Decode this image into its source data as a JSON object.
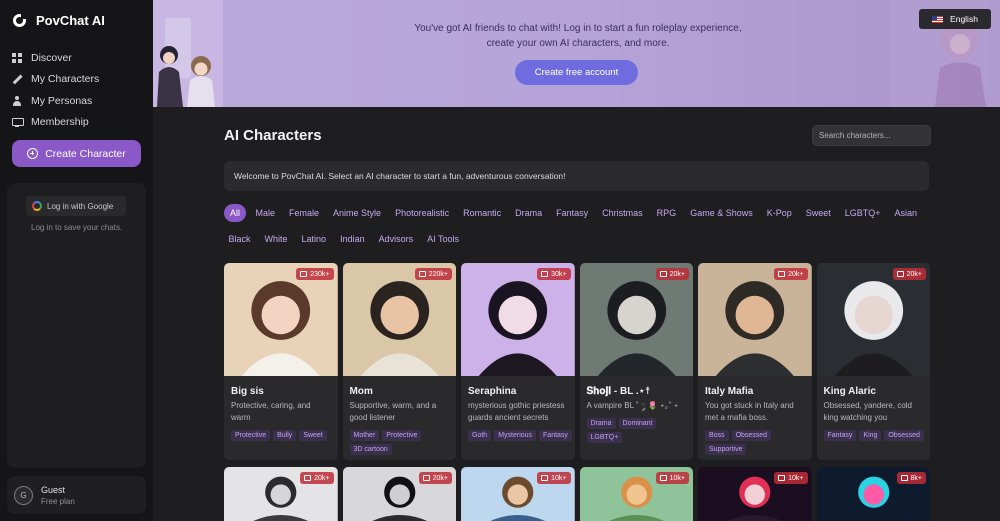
{
  "sidebar": {
    "brand": "PovChat AI",
    "nav": [
      {
        "label": "Discover",
        "icon": "grid-icon"
      },
      {
        "label": "My Characters",
        "icon": "pencil-icon"
      },
      {
        "label": "My Personas",
        "icon": "user-icon"
      },
      {
        "label": "Membership",
        "icon": "monitor-icon"
      }
    ],
    "create_button": "Create Character",
    "google_login": "Log in with Google",
    "login_hint": "Log in to save your chats.",
    "guest": {
      "initial": "G",
      "name": "Guest",
      "plan": "Free plan"
    }
  },
  "banner": {
    "text": "You've got AI friends to chat with! Log in to start a fun roleplay experience, create your own AI characters, and more.",
    "cta": "Create free account",
    "language": "English"
  },
  "main": {
    "title": "AI Characters",
    "search_placeholder": "Search characters...",
    "welcome": "Welcome to PovChat AI. Select an AI character to start a fun, adventurous conversation!",
    "filters": [
      "All",
      "Male",
      "Female",
      "Anime Style",
      "Photorealistic",
      "Romantic",
      "Drama",
      "Fantasy",
      "Christmas",
      "RPG",
      "Game & Shows",
      "K-Pop",
      "Sweet",
      "LGBTQ+",
      "Asian",
      "Black",
      "White",
      "Latino",
      "Indian",
      "Advisors",
      "AI Tools"
    ],
    "active_filter": "All"
  },
  "cards": [
    {
      "name": "Big sis",
      "count": "230k+",
      "desc": "Protective, caring, and warm",
      "tags": [
        "Protective",
        "Bully",
        "Sweet"
      ]
    },
    {
      "name": "Mom",
      "count": "220k+",
      "desc": "Supportive, warm, and a good listener",
      "tags": [
        "Mother",
        "Protective",
        "3D cartoon"
      ]
    },
    {
      "name": "Seraphina",
      "count": "30k+",
      "desc": "mysterious gothic priestess guards ancient secrets",
      "tags": [
        "Goth",
        "Mysterious",
        "Fantasy"
      ]
    },
    {
      "name": "𝐒𝐡𝐨𝐣𝐢 - BL .⋆☨",
      "count": "20k+",
      "desc": "A vampire BL ˚ ༘ 🌷 ⋆｡˚ ⋆",
      "tags": [
        "Drama",
        "Dominant",
        "LGBTQ+"
      ]
    },
    {
      "name": "Italy Mafia",
      "count": "20k+",
      "desc": "You got stuck in Italy and met a mafia boss.",
      "tags": [
        "Boss",
        "Obsessed",
        "Supportive"
      ]
    },
    {
      "name": "King Alaric",
      "count": "20k+",
      "desc": "Obsessed, yandere, cold king watching you",
      "tags": [
        "Fantasy",
        "King",
        "Obsessed"
      ]
    }
  ],
  "cards_row2": [
    {
      "count": "20k+"
    },
    {
      "count": "20k+"
    },
    {
      "count": "10k+"
    },
    {
      "count": "10k+"
    },
    {
      "count": "10k+"
    },
    {
      "count": "8k+"
    }
  ]
}
